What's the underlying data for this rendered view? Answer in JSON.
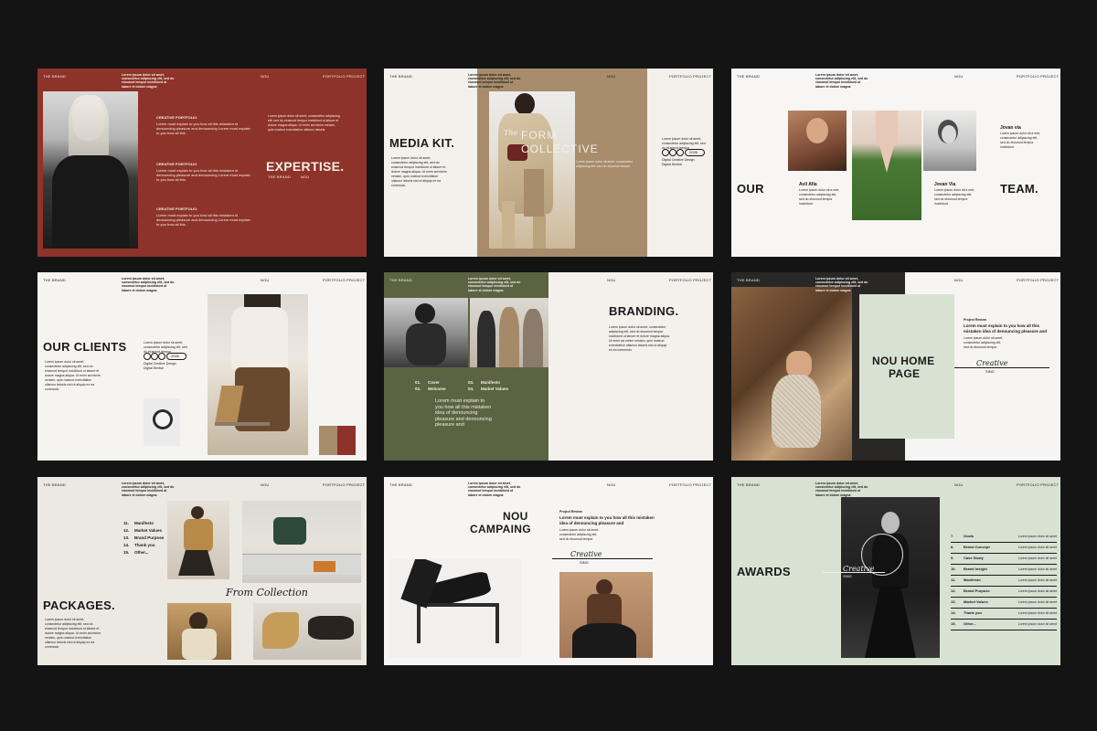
{
  "common": {
    "brand": "THE BRAND",
    "nou": "NOU",
    "portfolio_project": "PORTFOLIO PROJECT",
    "header_text": "Lorem ipsum dolor sit amet, consectetur adipiscing elit, sed do eiusmod tempor incididunt ut labore et dolore magna",
    "body_text": "Lorem ipsum dolor sit amet, consectetur adipiscing elit, sed do eiusmod tempor incididunt ut labore et dolore magna aliqua. Ut enim ad minim veniam, quis nostrud exercitation ullamco laboris nisi ut aliquip ex ea commodo",
    "short_text": "Lorem ipsum dolor sit amet, consectetur adipiscing elit, sed do eiusmod tempor",
    "creative_sing_1": "Creative",
    "creative_sing_2": "SING",
    "year": "2026"
  },
  "slide1": {
    "title": "EXPERTISE.",
    "items": [
      {
        "heading": "CREATIVE PORTFOLIO",
        "text": "Lorem must explain to you how all this mistaken id denouncing pleasure and denouncing Lorem must explain to you how all this."
      },
      {
        "heading": "CREATIVE PORTFOLIO",
        "text": "Lorem must explain to you how all this mistaken id denouncing pleasure and denouncing Lorem must explain to you how all this."
      },
      {
        "heading": "CREATIVE PORTFOLIO",
        "text": "Lorem must explain to you how all this mistaken id denouncing pleasure and denouncing Lorem must explain to you how all this."
      }
    ],
    "bullet": "Lorem ipsum dolor sit amet, consectetur adipiscing elit, sed do eiusmod tempor incididunt ut labore et dolore magna aliqua. Ut enim ad minim veniam, quis nostrud exercitation ullamco laboris."
  },
  "slide2": {
    "title": "MEDIA KIT.",
    "overlay_script": "The",
    "overlay_1": "FORM",
    "overlay_2": "COLLECTIVE",
    "contact": "Digital Creative Design Digital Sentral"
  },
  "slide3": {
    "left": "OUR",
    "right": "TEAM.",
    "members": [
      {
        "name": "Avil Afia",
        "text": "Lorem ipsum dolor sit a met, consectetur adipiscing elit, sed do eiusmod tempor incididunt"
      },
      {
        "name": "Jovan Via",
        "text": "Lorem ipsum dolor sit a met, consectetur adipiscing elit, sed do eiusmod tempor incididunt"
      },
      {
        "name": "Jovan via",
        "text": "Lorem ipsum dolor sit a met, consectetur adipiscing elit, sed do eiusmod tempor incididunt"
      }
    ]
  },
  "slide4": {
    "title": "OUR CLIENTS"
  },
  "slide5": {
    "title": "BRANDING.",
    "list": [
      {
        "num": "01.",
        "label": "Cover"
      },
      {
        "num": "02.",
        "label": "Welcome"
      },
      {
        "num": "03.",
        "label": "Manifesto"
      },
      {
        "num": "04.",
        "label": "Market Values"
      }
    ],
    "paragraph": "Lorem must explain to you how all this mistaken idea of denouncing pleasure and denouncing pleasure and"
  },
  "slide6": {
    "title_1": "NOU HOME",
    "title_2": "PAGE",
    "project_review": "Project Review",
    "heading": "Lorem must explain to you how all this mistaken idea of denouncing pleasure and"
  },
  "slide7": {
    "title": "PACKAGES.",
    "list": [
      {
        "num": "11.",
        "label": "Manifesto"
      },
      {
        "num": "12.",
        "label": "Market Values"
      },
      {
        "num": "13.",
        "label": "Brand Purpose"
      },
      {
        "num": "14.",
        "label": "Thank you"
      },
      {
        "num": "15.",
        "label": "Other..."
      }
    ],
    "script": "From Collection"
  },
  "slide8": {
    "title_1": "NOU",
    "title_2": "CAMPAING",
    "project_review": "Project Review",
    "heading": "Lorem must explain to you how all this mistaken idea of denouncing pleasure and"
  },
  "slide9": {
    "title": "AWARDS",
    "list": [
      {
        "num": "7.",
        "label": "Goals"
      },
      {
        "num": "8.",
        "label": "Brand Concept"
      },
      {
        "num": "9.",
        "label": "Case Study"
      },
      {
        "num": "10.",
        "label": "Brand Insight"
      },
      {
        "num": "11.",
        "label": "Manifesto"
      },
      {
        "num": "12.",
        "label": "Brand Purpose"
      },
      {
        "num": "13.",
        "label": "Market Values"
      },
      {
        "num": "14.",
        "label": "Thank you"
      },
      {
        "num": "15.",
        "label": "Other..."
      }
    ],
    "item_text": "Lorem ipsum dolor sit amet"
  },
  "colors": {
    "background": "#141414",
    "maroon": "#8e3329",
    "tan": "#a88c6b",
    "olive": "#5b6343",
    "sage": "#d8e2d3",
    "cream": "#f4f1ec",
    "linen": "#ece8e2"
  }
}
